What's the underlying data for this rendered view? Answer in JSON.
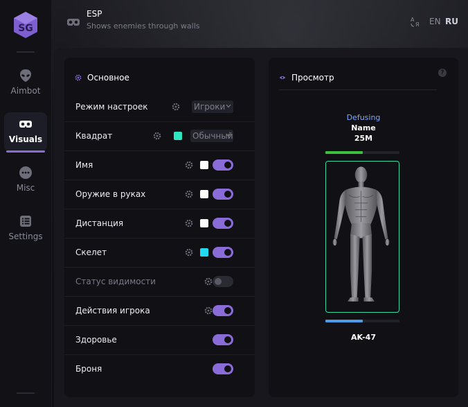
{
  "sidebar": {
    "logo_icon": "sg-cube-logo",
    "items": [
      {
        "label": "Aimbot",
        "icon": "alien-icon",
        "active": false
      },
      {
        "label": "Visuals",
        "icon": "vr-goggles-icon",
        "active": true
      },
      {
        "label": "Misc",
        "icon": "dots-icon",
        "active": false
      },
      {
        "label": "Settings",
        "icon": "list-icon",
        "active": false
      }
    ]
  },
  "header": {
    "title": "ESP",
    "subtitle": "Shows enemies through walls",
    "lang_en": "EN",
    "lang_ru": "RU"
  },
  "main_panel": {
    "title": "Основное",
    "rows": [
      {
        "label": "Режим настроек",
        "select": "Игроки"
      },
      {
        "label": "Квадрат",
        "color": "#2ee6c0",
        "select": "Обычный"
      },
      {
        "label": "Имя",
        "color": "#ffffff",
        "toggle": true
      },
      {
        "label": "Оружие в руках",
        "color": "#ffffff",
        "toggle": true
      },
      {
        "label": "Дистанция",
        "color": "#ffffff",
        "toggle": true
      },
      {
        "label": "Скелет",
        "color": "#22d9f2",
        "toggle": true
      },
      {
        "label": "Статус видимости",
        "toggle": false
      },
      {
        "label": "Действия игрока",
        "toggle": true
      },
      {
        "label": "Здоровье",
        "toggle": true
      },
      {
        "label": "Броня",
        "toggle": true
      }
    ]
  },
  "preview_panel": {
    "title": "Просмотр",
    "help": "?",
    "status": "Defusing",
    "name": "Name",
    "distance": "25M",
    "health_level": 0.5,
    "armor_level": 0.5,
    "weapon": "AK-47"
  },
  "colors": {
    "accent": "#8a6cd9",
    "box": "#37d8a6",
    "health": "#3fbf3f",
    "armor": "#4a9be8"
  }
}
